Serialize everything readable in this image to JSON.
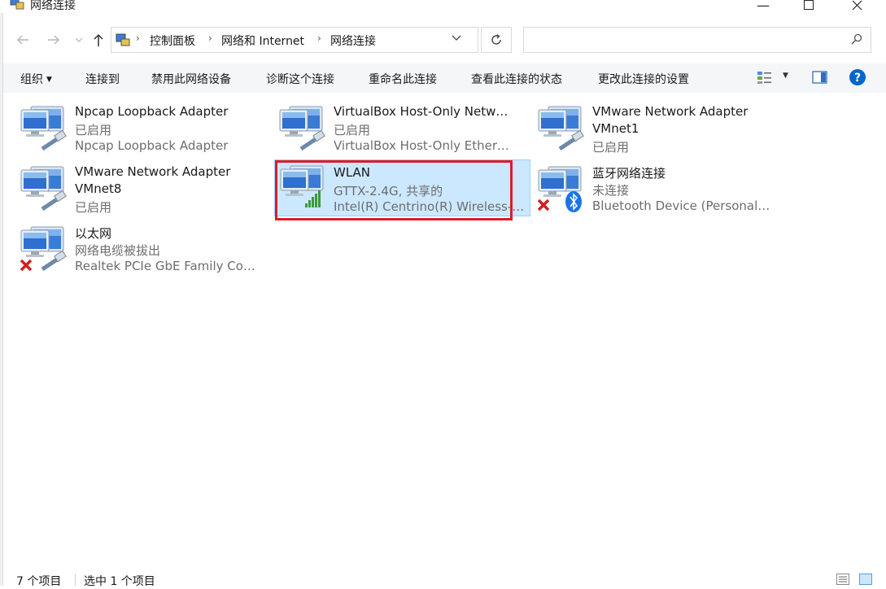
{
  "window": {
    "title": "网络连接"
  },
  "address": {
    "crumbs": [
      "控制面板",
      "网络和 Internet",
      "网络连接"
    ],
    "search_placeholder": ""
  },
  "toolbar": {
    "organize": "组织",
    "connect_to": "连接到",
    "disable_device": "禁用此网络设备",
    "diagnose": "诊断这个连接",
    "rename": "重命名此连接",
    "view_status": "查看此连接的状态",
    "change_settings": "更改此连接的设置"
  },
  "connections": [
    {
      "name": "Npcap Loopback Adapter",
      "status": "已启用",
      "device": "Npcap Loopback Adapter",
      "icon": "wired-network-icon"
    },
    {
      "name": "VirtualBox Host-Only Network",
      "status": "已启用",
      "device": "VirtualBox Host-Only Ethernet ...",
      "icon": "wired-network-icon"
    },
    {
      "name": "VMware Network Adapter",
      "name2": "VMnet1",
      "status": "已启用",
      "icon": "wired-network-icon"
    },
    {
      "name": "VMware Network Adapter",
      "name2": "VMnet8",
      "status": "已启用",
      "icon": "wired-network-icon"
    },
    {
      "name": "WLAN",
      "status": "GTTX-2.4G, 共享的",
      "device": "Intel(R) Centrino(R) Wireless-N...",
      "icon": "wifi-signal-icon",
      "selected": true
    },
    {
      "name": "蓝牙网络连接",
      "status": "未连接",
      "device": "Bluetooth Device (Personal Ar...",
      "icon": "bluetooth-icon"
    },
    {
      "name": "以太网",
      "status": "网络电缆被拔出",
      "device": "Realtek PCIe GbE Family Contr...",
      "icon": "disconnected-x-icon"
    }
  ],
  "statusbar": {
    "count": "7 个项目",
    "selected": "选中 1 个项目"
  },
  "colors": {
    "selection_bg": "#cce8ff",
    "selection_border": "#99d1ff",
    "highlight_box": "#e01b24",
    "help_blue": "#0066cc"
  }
}
